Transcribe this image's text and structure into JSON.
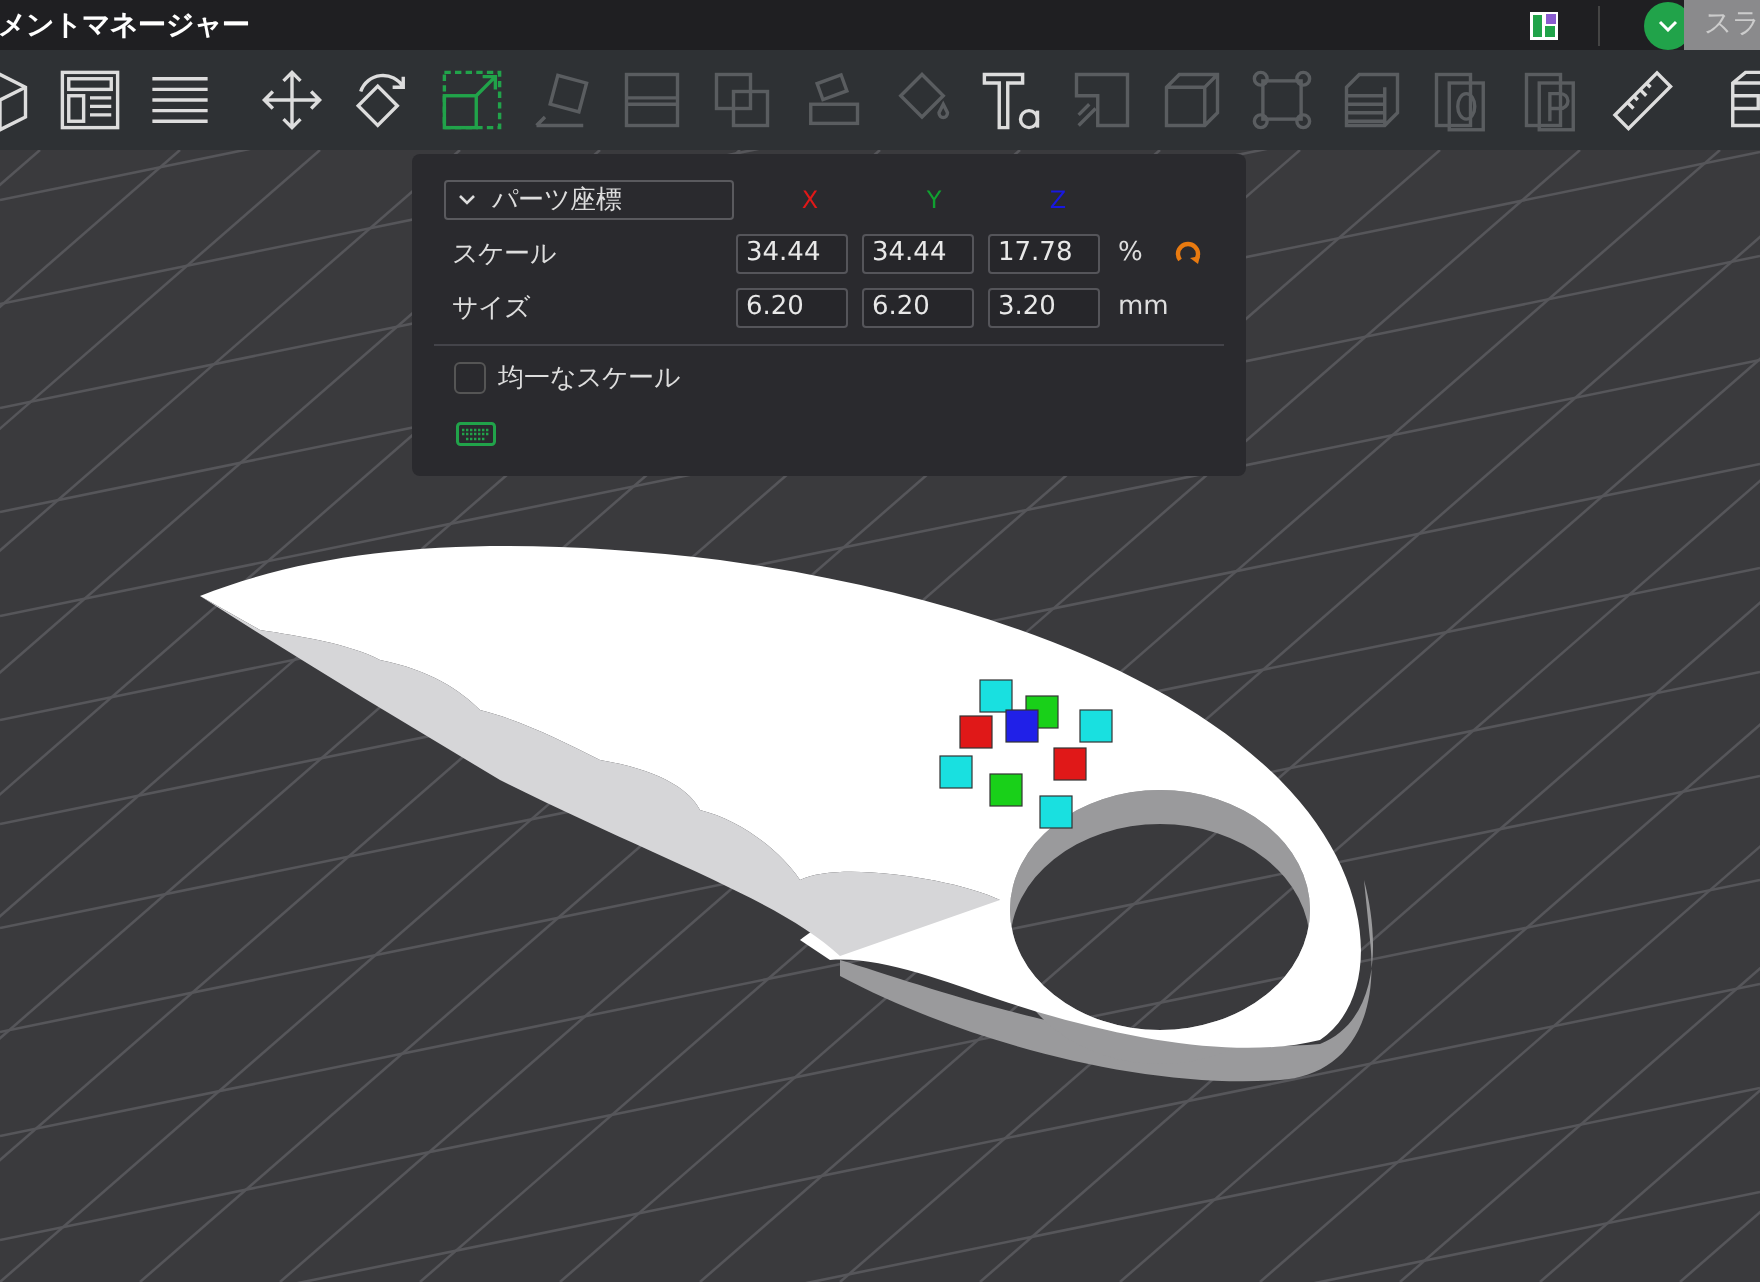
{
  "window": {
    "title": "メントマネージャー"
  },
  "title_bar": {
    "tab_label": "スラ"
  },
  "toolbar": {
    "items": [
      {
        "kind": "cube",
        "disabled": false,
        "selected": false
      },
      {
        "kind": "layout",
        "disabled": false,
        "selected": false
      },
      {
        "kind": "list",
        "disabled": false,
        "selected": false
      },
      {
        "kind": "separator"
      },
      {
        "kind": "move",
        "disabled": false,
        "selected": false
      },
      {
        "kind": "rotate",
        "disabled": false,
        "selected": false
      },
      {
        "kind": "scale",
        "disabled": false,
        "selected": true
      },
      {
        "kind": "lay",
        "disabled": true,
        "selected": false
      },
      {
        "kind": "split",
        "disabled": true,
        "selected": false
      },
      {
        "kind": "boolean",
        "disabled": true,
        "selected": false
      },
      {
        "kind": "cut",
        "disabled": true,
        "selected": false
      },
      {
        "kind": "paint",
        "disabled": true,
        "selected": false
      },
      {
        "kind": "text",
        "disabled": false,
        "selected": false
      },
      {
        "kind": "corner",
        "disabled": true,
        "selected": false
      },
      {
        "kind": "box",
        "disabled": true,
        "selected": false
      },
      {
        "kind": "frame",
        "disabled": true,
        "selected": false
      },
      {
        "kind": "layers",
        "disabled": true,
        "selected": false
      },
      {
        "kind": "page-o",
        "disabled": true,
        "selected": false
      },
      {
        "kind": "page-p",
        "disabled": true,
        "selected": false
      },
      {
        "kind": "ruler",
        "disabled": false,
        "selected": false
      },
      {
        "kind": "separator"
      },
      {
        "kind": "assembly",
        "disabled": false,
        "selected": false
      }
    ]
  },
  "panel": {
    "coordinate_dropdown": {
      "value": "パーツ座標"
    },
    "axes": [
      {
        "label": "X",
        "color": "#e01818"
      },
      {
        "label": "Y",
        "color": "#10a030"
      },
      {
        "label": "Z",
        "color": "#1818e0"
      }
    ],
    "rows": [
      {
        "label": "スケール",
        "values": [
          "34.44",
          "34.44",
          "17.78"
        ],
        "unit": "%",
        "reset": true
      },
      {
        "label": "サイズ",
        "values": [
          "6.20",
          "6.20",
          "3.20"
        ],
        "unit": "mm",
        "reset": false
      }
    ],
    "uniform_scale": {
      "label": "均一なスケール",
      "checked": false
    }
  }
}
